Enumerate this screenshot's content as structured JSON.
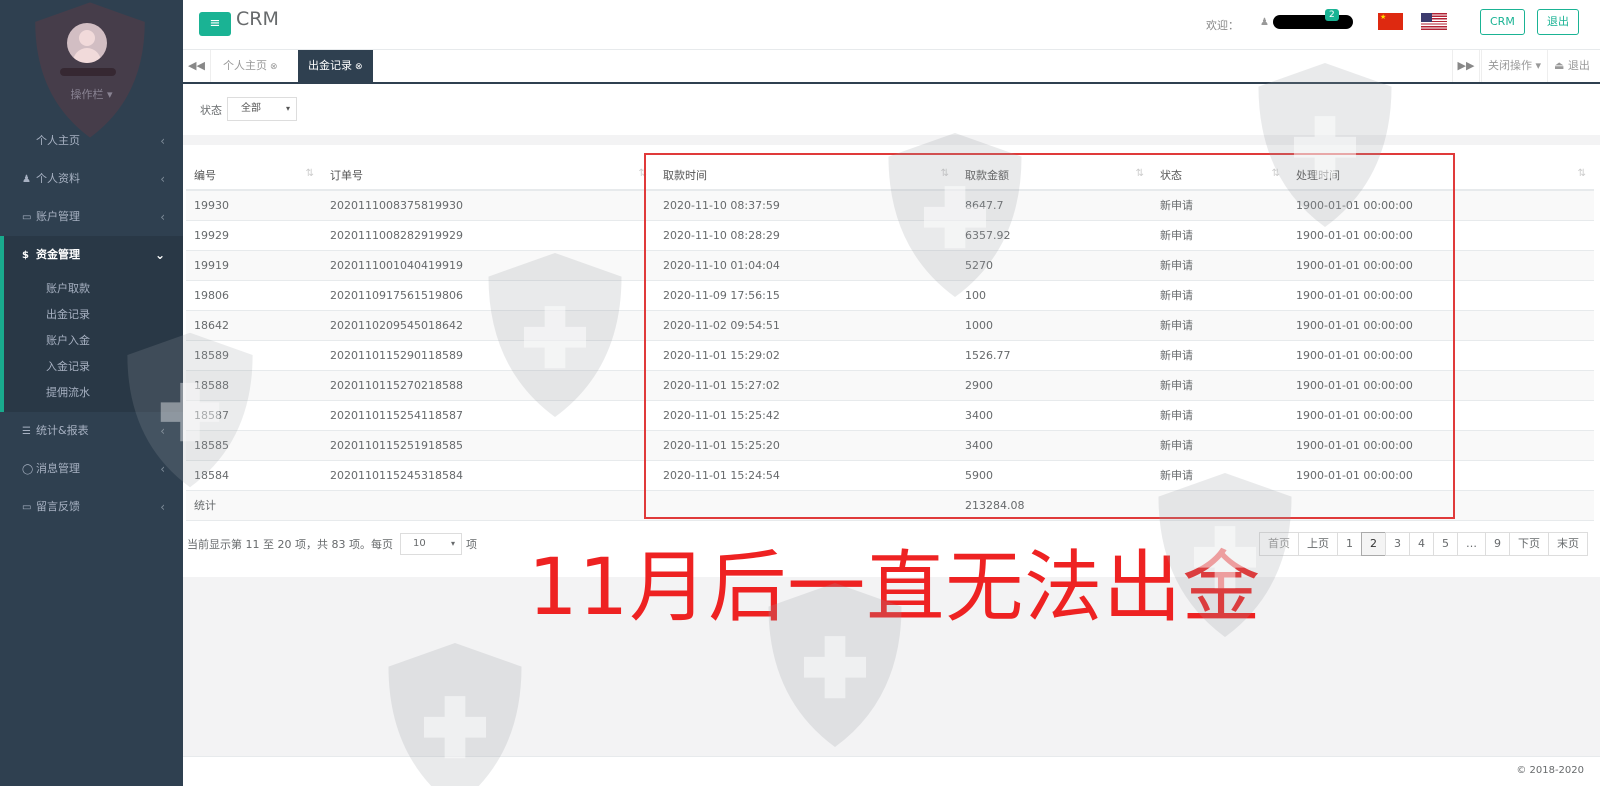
{
  "sidebar": {
    "ops_label": "操作栏 ▾",
    "items": [
      {
        "label": "个人主页",
        "icon": "home-icon",
        "glyph": ""
      },
      {
        "label": "个人资料",
        "icon": "user-icon",
        "glyph": "♟"
      },
      {
        "label": "账户管理",
        "icon": "card-icon",
        "glyph": "▭"
      },
      {
        "label": "资金管理",
        "icon": "dollar-icon",
        "glyph": "$"
      },
      {
        "label": "统计&报表",
        "icon": "list-icon",
        "glyph": "☰"
      },
      {
        "label": "消息管理",
        "icon": "chat-icon",
        "glyph": "◯"
      },
      {
        "label": "留言反馈",
        "icon": "keyboard-icon",
        "glyph": "▭"
      }
    ],
    "subitems": [
      "账户取款",
      "出金记录",
      "账户入金",
      "入金记录",
      "提佣流水"
    ],
    "chevron_collapsed": "‹",
    "chevron_open": "⌄"
  },
  "topbar": {
    "menu_glyph": "≡",
    "brand": "CRM",
    "welcome": "欢迎：",
    "badge": "2",
    "crm_button": "CRM",
    "logout_button": "退出"
  },
  "tabs": {
    "items": [
      "个人主页",
      "出金记录"
    ],
    "close_glyph": "⊗",
    "close_ops": "关闭操作 ▾",
    "logout": "⏏ 退出",
    "prev_glyph": "◀◀",
    "next_glyph": "▶▶"
  },
  "filter": {
    "label": "状态",
    "value": "全部",
    "arrow": "▾"
  },
  "table": {
    "headers": [
      "编号",
      "订单号",
      "取款时间",
      "取款金额",
      "状态",
      "处理时间"
    ],
    "rows": [
      [
        "19930",
        "2020111008375819930",
        "2020-11-10 08:37:59",
        "8647.7",
        "新申请",
        "1900-01-01 00:00:00"
      ],
      [
        "19929",
        "2020111008282919929",
        "2020-11-10 08:28:29",
        "6357.92",
        "新申请",
        "1900-01-01 00:00:00"
      ],
      [
        "19919",
        "2020111001040419919",
        "2020-11-10 01:04:04",
        "5270",
        "新申请",
        "1900-01-01 00:00:00"
      ],
      [
        "19806",
        "2020110917561519806",
        "2020-11-09 17:56:15",
        "100",
        "新申请",
        "1900-01-01 00:00:00"
      ],
      [
        "18642",
        "2020110209545018642",
        "2020-11-02 09:54:51",
        "1000",
        "新申请",
        "1900-01-01 00:00:00"
      ],
      [
        "18589",
        "2020110115290118589",
        "2020-11-01 15:29:02",
        "1526.77",
        "新申请",
        "1900-01-01 00:00:00"
      ],
      [
        "18588",
        "2020110115270218588",
        "2020-11-01 15:27:02",
        "2900",
        "新申请",
        "1900-01-01 00:00:00"
      ],
      [
        "18587",
        "2020110115254118587",
        "2020-11-01 15:25:42",
        "3400",
        "新申请",
        "1900-01-01 00:00:00"
      ],
      [
        "18585",
        "2020110115251918585",
        "2020-11-01 15:25:20",
        "3400",
        "新申请",
        "1900-01-01 00:00:00"
      ],
      [
        "18584",
        "2020110115245318584",
        "2020-11-01 15:24:54",
        "5900",
        "新申请",
        "1900-01-01 00:00:00"
      ]
    ],
    "summary_label": "统计",
    "summary_total": "213284.08"
  },
  "pagination": {
    "info": "当前显示第 11 至 20 项，共 83 项。每页",
    "per_page": "10",
    "suffix": "项",
    "buttons": [
      "首页",
      "上页",
      "1",
      "2",
      "3",
      "4",
      "5",
      "…",
      "9",
      "下页",
      "末页"
    ],
    "current": "2"
  },
  "overlay_text": "11月后一直无法出金",
  "footer": "© 2018-2020",
  "colors": {
    "accent": "#1ab394",
    "sidebar": "#2f4050",
    "annotation": "#e22222"
  }
}
